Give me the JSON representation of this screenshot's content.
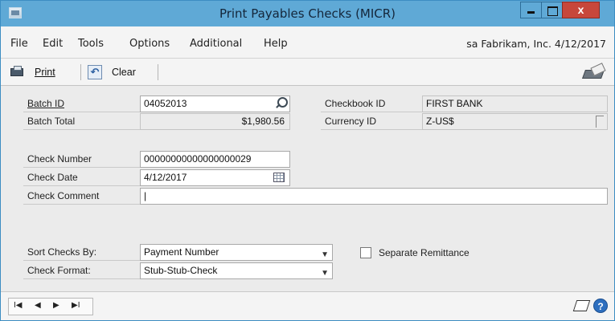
{
  "window": {
    "title": "Print Payables Checks (MICR)"
  },
  "menu": {
    "items": [
      "File",
      "Edit",
      "Tools",
      "Options",
      "Additional",
      "Help"
    ],
    "status_text": "sa  Fabrikam, Inc. 4/12/2017"
  },
  "toolbar": {
    "print_label": "Print",
    "clear_label": "Clear"
  },
  "form": {
    "batch_id_label": "Batch ID",
    "batch_id_value": "04052013",
    "batch_total_label": "Batch Total",
    "batch_total_value": "$1,980.56",
    "checkbook_id_label": "Checkbook ID",
    "checkbook_id_value": "FIRST BANK",
    "currency_id_label": "Currency ID",
    "currency_id_value": "Z-US$",
    "check_number_label": "Check Number",
    "check_number_value": "00000000000000000029",
    "check_date_label": "Check Date",
    "check_date_value": "4/12/2017",
    "check_comment_label": "Check Comment",
    "check_comment_value": "|",
    "sort_checks_by_label": "Sort Checks By:",
    "sort_checks_by_value": "Payment Number",
    "check_format_label": "Check Format:",
    "check_format_value": "Stub-Stub-Check",
    "separate_remittance_label": "Separate Remittance",
    "separate_remittance_checked": false
  },
  "statusbar": {
    "nav_first": "I◀",
    "nav_prev": "◀",
    "nav_next": "▶",
    "nav_last": "▶I"
  },
  "icons": {
    "app": "app-window-icon",
    "lookup": "magnifier-lookup-icon",
    "calendar": "calendar-icon",
    "note": "note-icon",
    "help": "help-icon"
  }
}
